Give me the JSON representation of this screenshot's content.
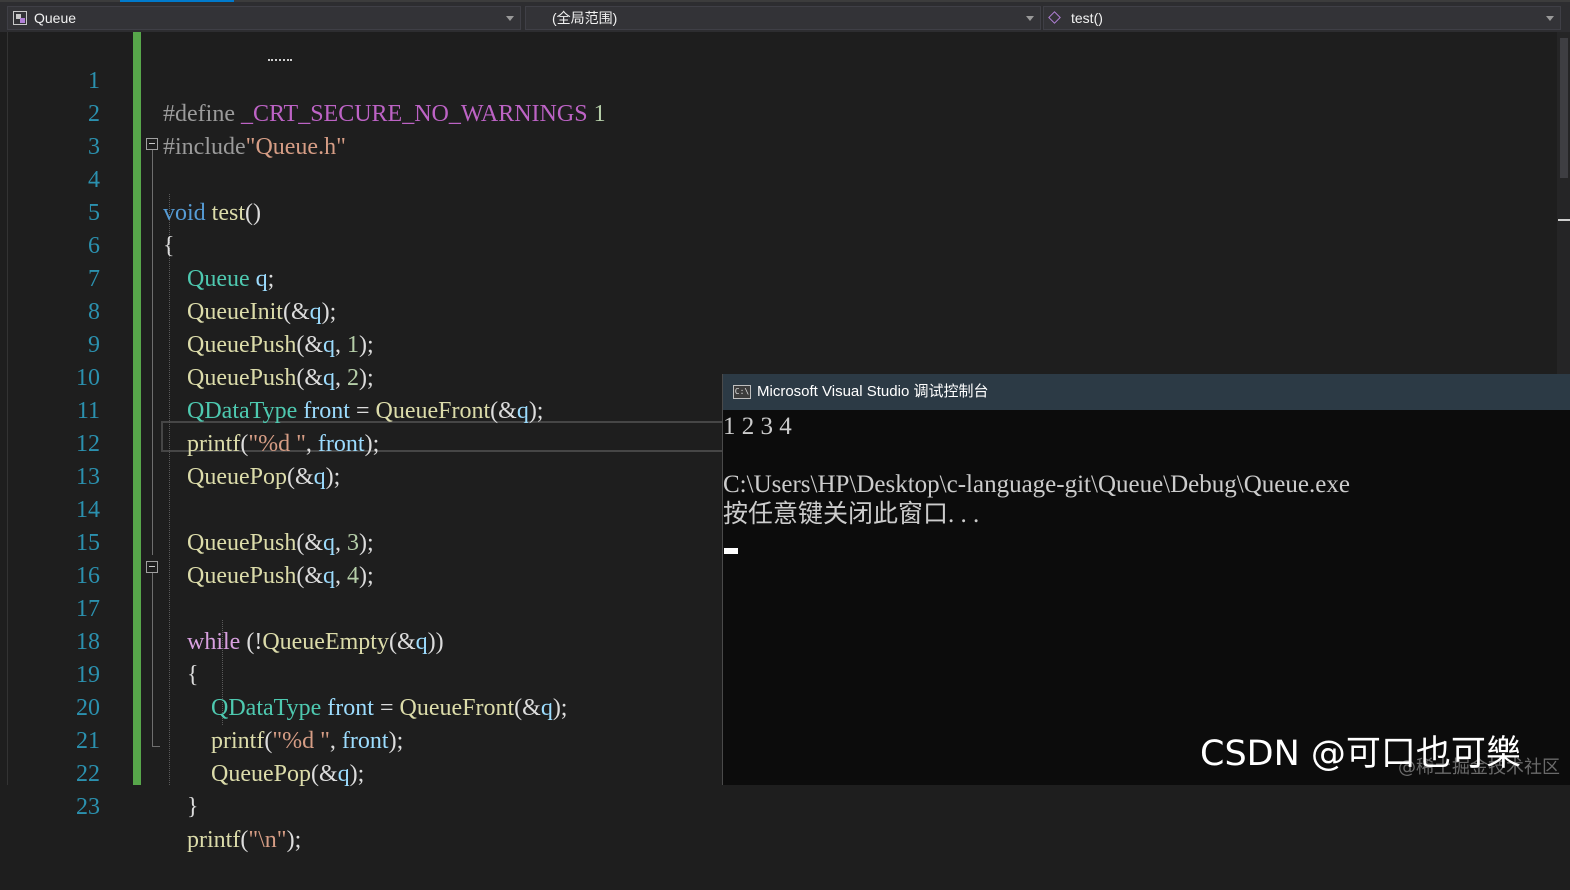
{
  "navigation": {
    "project": "Queue",
    "scope": "(全局范围)",
    "member": "test()"
  },
  "editor": {
    "line_numbers": [
      "1",
      "2",
      "3",
      "4",
      "5",
      "6",
      "7",
      "8",
      "9",
      "10",
      "11",
      "12",
      "13",
      "14",
      "15",
      "16",
      "17",
      "18",
      "19",
      "20",
      "21",
      "22",
      "23"
    ],
    "lines": [
      "#define _CRT_SECURE_NO_WARNINGS 1",
      "#include\"Queue.h\"",
      "",
      "void test()",
      "{",
      "    Queue q;",
      "    QueueInit(&q);",
      "    QueuePush(&q, 1);",
      "    QueuePush(&q, 2);",
      "    QDataType front = QueueFront(&q);",
      "    printf(\"%d \", front);",
      "    QueuePop(&q);",
      "",
      "    QueuePush(&q, 3);",
      "    QueuePush(&q, 4);",
      "",
      "    while (!QueueEmpty(&q))",
      "    {",
      "        QDataType front = QueueFront(&q);",
      "        printf(\"%d \", front);",
      "        QueuePop(&q);",
      "    }",
      "    printf(\"\\n\");"
    ]
  },
  "console": {
    "title": "Microsoft Visual Studio 调试控制台",
    "icon_text": "C:\\",
    "output_lines": [
      "1 2 3 4",
      "",
      "C:\\Users\\HP\\Desktop\\c-language-git\\Queue\\Debug\\Queue.exe",
      "按任意键关闭此窗口. . ."
    ]
  },
  "watermark": {
    "text": "CSDN @可口也可樂",
    "sub": "@稀土掘金技术社区"
  },
  "colors": {
    "background": "#1e1e1e",
    "line_number": "#2b91af",
    "keyword": "#569cd6",
    "type": "#4ec9b0",
    "function": "#dcdcaa",
    "variable": "#9cdcfe",
    "string": "#d69d85",
    "number": "#b5cea8",
    "change_bar": "#57a64a",
    "console_title_bg": "#2c3a45"
  }
}
